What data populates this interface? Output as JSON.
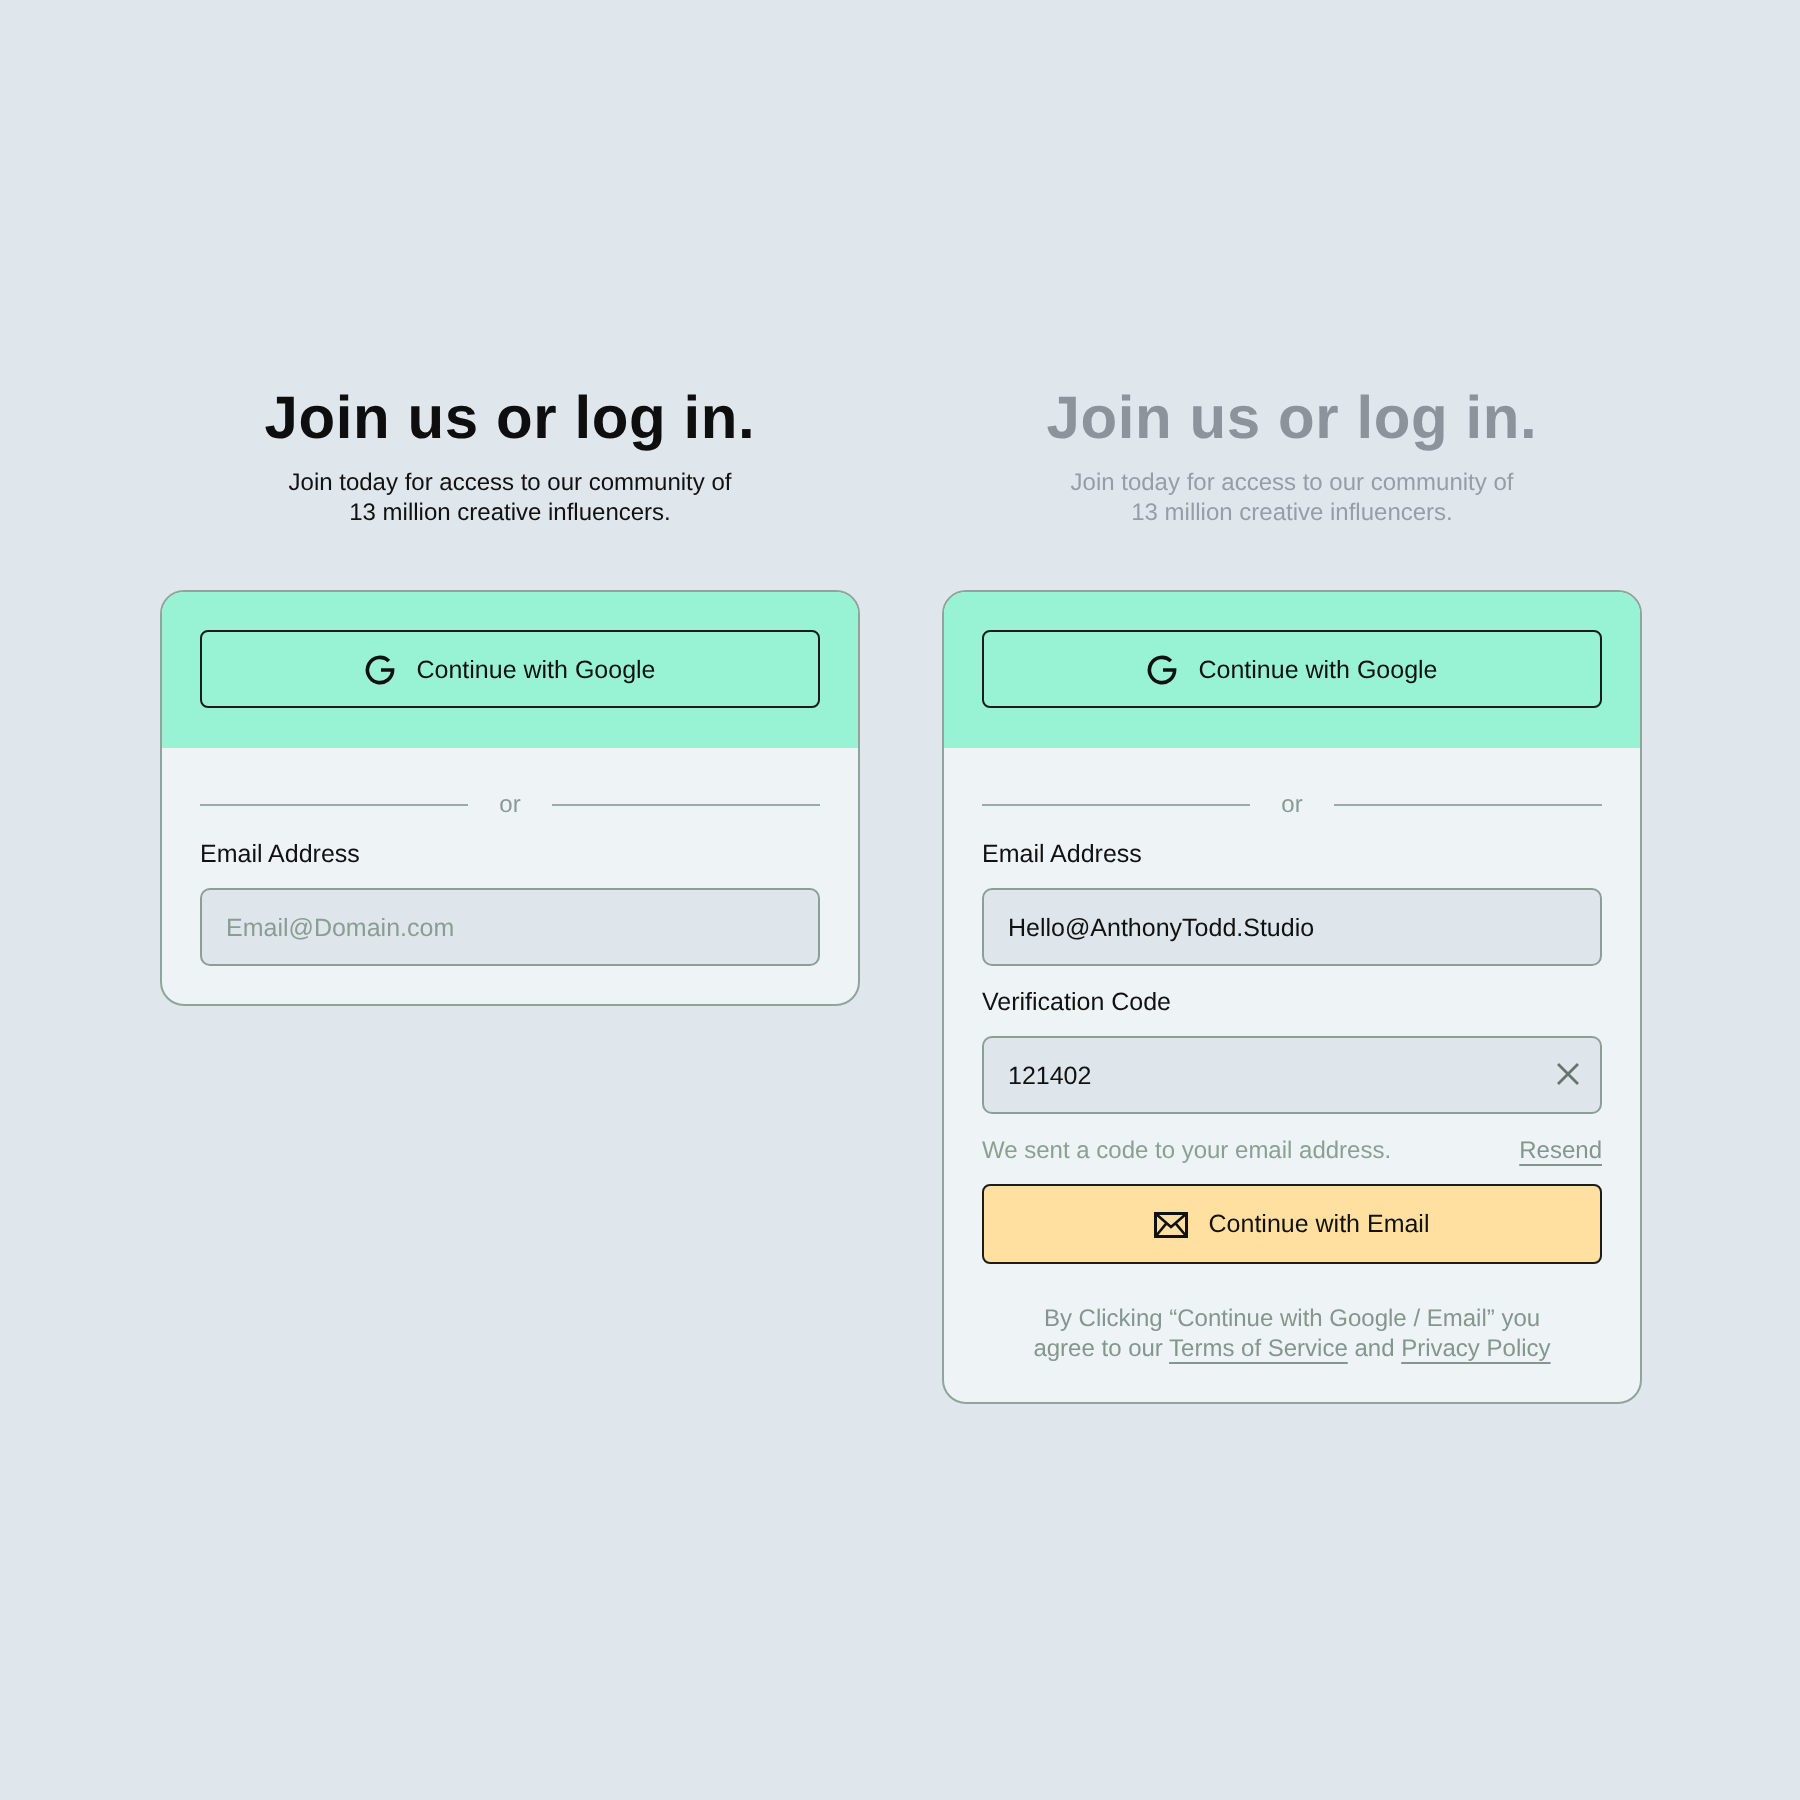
{
  "panels": [
    {
      "heading": {
        "title": "Join us or log in.",
        "subtitle": "Join today for access to our community of\n13 million creative influencers.",
        "dimmed": false
      },
      "card": {
        "google_button": {
          "label": "Continue with Google"
        },
        "divider": "or",
        "fields": [
          {
            "label": "Email Address",
            "placeholder": "Email@Domain.com",
            "clearable": false
          }
        ]
      }
    },
    {
      "heading": {
        "title": "Join us or log in.",
        "subtitle": "Join today for access to our community of\n13 million creative influencers.",
        "dimmed": true
      },
      "card": {
        "google_button": {
          "label": "Continue with Google"
        },
        "divider": "or",
        "fields": [
          {
            "label": "Email Address",
            "value": "Hello@AnthonyTodd.Studio",
            "clearable": false
          },
          {
            "label": "Verification Code",
            "value": "121402",
            "clearable": true
          }
        ],
        "note": {
          "text": "We sent a code to your email address.",
          "link": "Resend"
        },
        "email_button": {
          "label": "Continue with Email"
        },
        "legal": [
          {
            "kind": "text",
            "text": "By Clicking “Continue with Google / Email” you\nagree to our "
          },
          {
            "kind": "link",
            "text": "Terms of Service"
          },
          {
            "kind": "text",
            "text": " and "
          },
          {
            "kind": "link",
            "text": "Privacy Policy"
          }
        ]
      }
    }
  ]
}
